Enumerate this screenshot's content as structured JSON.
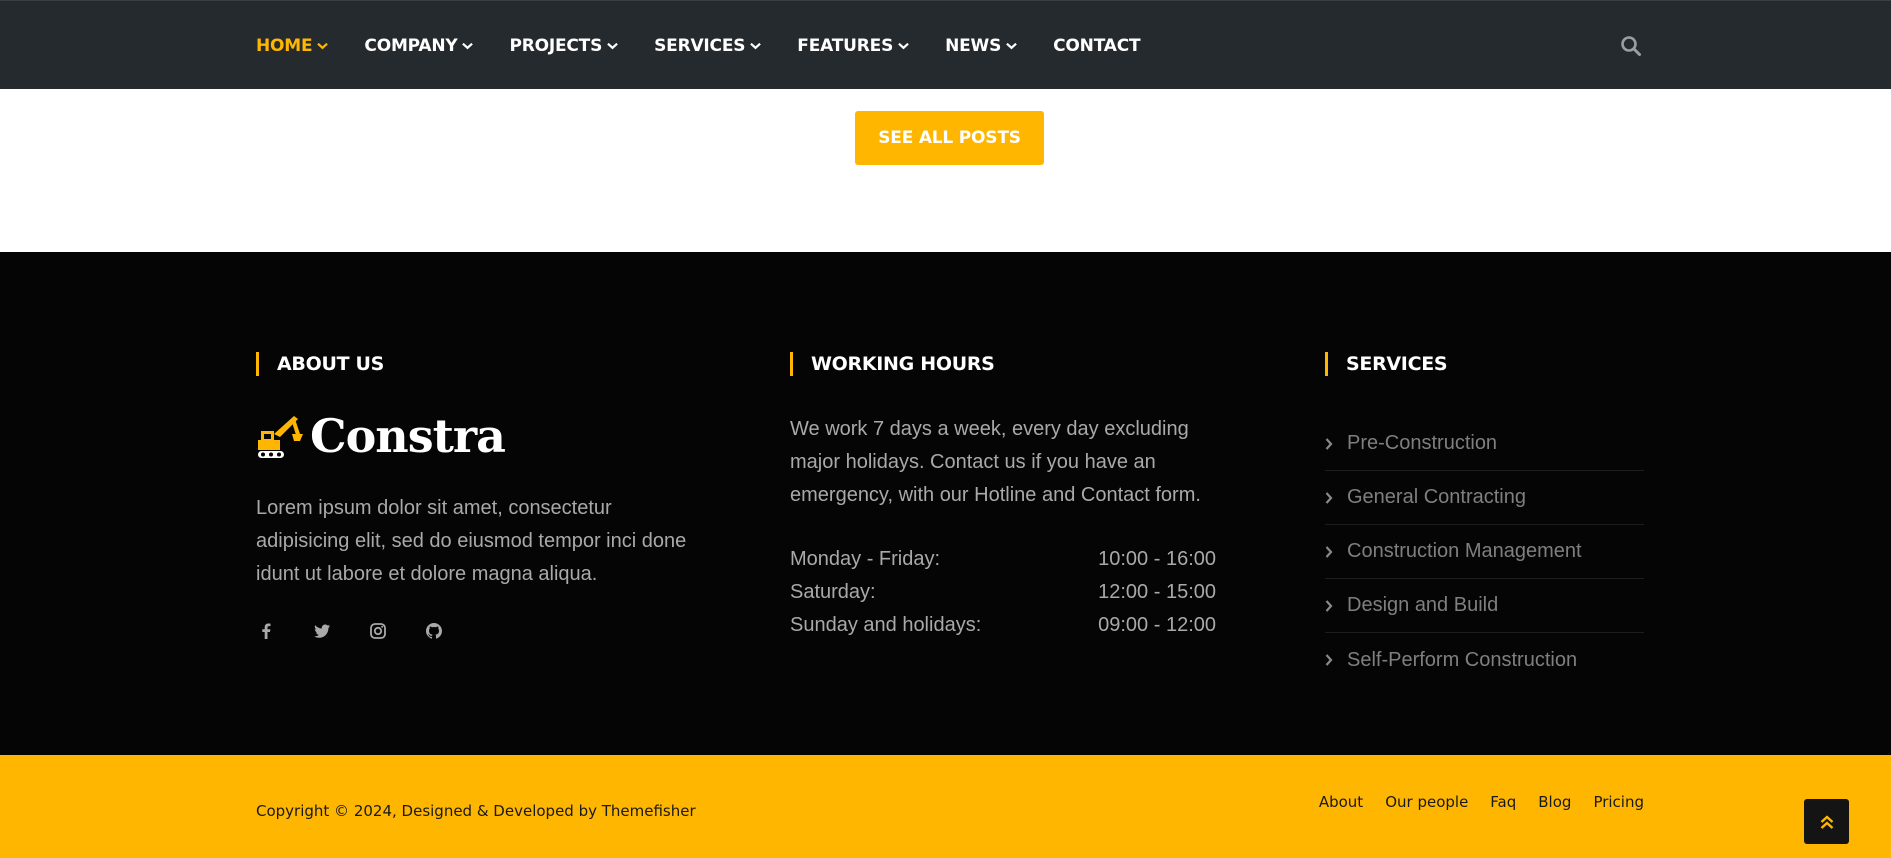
{
  "nav": {
    "items": [
      {
        "label": "HOME",
        "has_dropdown": true,
        "active": true
      },
      {
        "label": "COMPANY",
        "has_dropdown": true
      },
      {
        "label": "PROJECTS",
        "has_dropdown": true
      },
      {
        "label": "SERVICES",
        "has_dropdown": true
      },
      {
        "label": "FEATURES",
        "has_dropdown": true
      },
      {
        "label": "NEWS",
        "has_dropdown": true
      },
      {
        "label": "CONTACT",
        "has_dropdown": false
      }
    ],
    "search_icon": "search-icon"
  },
  "posts": {
    "see_all_label": "SEE ALL POSTS"
  },
  "footer": {
    "about": {
      "title": "ABOUT US",
      "logo_text": "Constra",
      "logo_icon": "excavator-icon",
      "text": "Lorem ipsum dolor sit amet, consectetur adipisicing elit, sed do eiusmod tempor inci done idunt ut labore et dolore magna aliqua.",
      "socials": [
        "facebook-icon",
        "twitter-icon",
        "instagram-icon",
        "github-icon"
      ]
    },
    "hours": {
      "title": "WORKING HOURS",
      "text": "We work 7 days a week, every day excluding major holidays. Contact us if you have an emergency, with our Hotline and Contact form.",
      "rows": [
        {
          "day": "Monday - Friday:",
          "time": "10:00 - 16:00"
        },
        {
          "day": "Saturday:",
          "time": "12:00 - 15:00"
        },
        {
          "day": "Sunday and holidays:",
          "time": "09:00 - 12:00"
        }
      ]
    },
    "services": {
      "title": "SERVICES",
      "items": [
        "Pre-Construction",
        "General Contracting",
        "Construction Management",
        "Design and Build",
        "Self-Perform Construction"
      ]
    }
  },
  "copyright": {
    "text": "Copyright © 2024, Designed & Developed by Themefisher",
    "links": [
      "About",
      "Our people",
      "Faq",
      "Blog",
      "Pricing"
    ]
  },
  "colors": {
    "accent": "#ffb600",
    "nav_bg": "#252a2f",
    "footer_bg": "#050505"
  }
}
